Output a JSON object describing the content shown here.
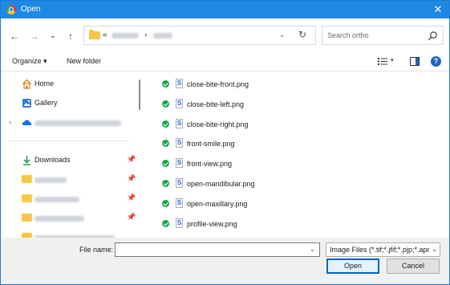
{
  "window": {
    "title": "Open",
    "close_symbol": "✕"
  },
  "nav": {
    "back": "←",
    "forward": "→",
    "recent": "⌄",
    "up": "↑"
  },
  "address": {
    "prefix": "«",
    "separator": "›",
    "dropdown": "⌄",
    "refresh": "↻"
  },
  "search": {
    "placeholder": "Search ortho"
  },
  "commands": {
    "organize": "Organize ▾",
    "new_folder": "New folder",
    "view_dropdown": "▾",
    "help": "?"
  },
  "sidebar": {
    "home": "Home",
    "gallery": "Gallery",
    "expander": "›",
    "downloads": "Downloads",
    "pin": "📌"
  },
  "files": [
    "close-bite-front.png",
    "close-bite-left.png",
    "close-bite-right.png",
    "front-smile.png",
    "front-view.png",
    "open-mandibular.png",
    "open-maxillary.png",
    "profile-view.png"
  ],
  "bottom": {
    "file_name_label": "File name:",
    "file_name_value": "",
    "file_name_dropdown": "⌄",
    "file_type": "Image Files (*.tif;*.jfif;*.pjp;*.apng)",
    "file_type_dropdown": "⌄",
    "open_label": "Open",
    "cancel_label": "Cancel"
  },
  "colors": {
    "titlebar": "#1e88e5",
    "accent": "#0067c0",
    "check": "#16a34a",
    "folder": "#f6c744"
  }
}
